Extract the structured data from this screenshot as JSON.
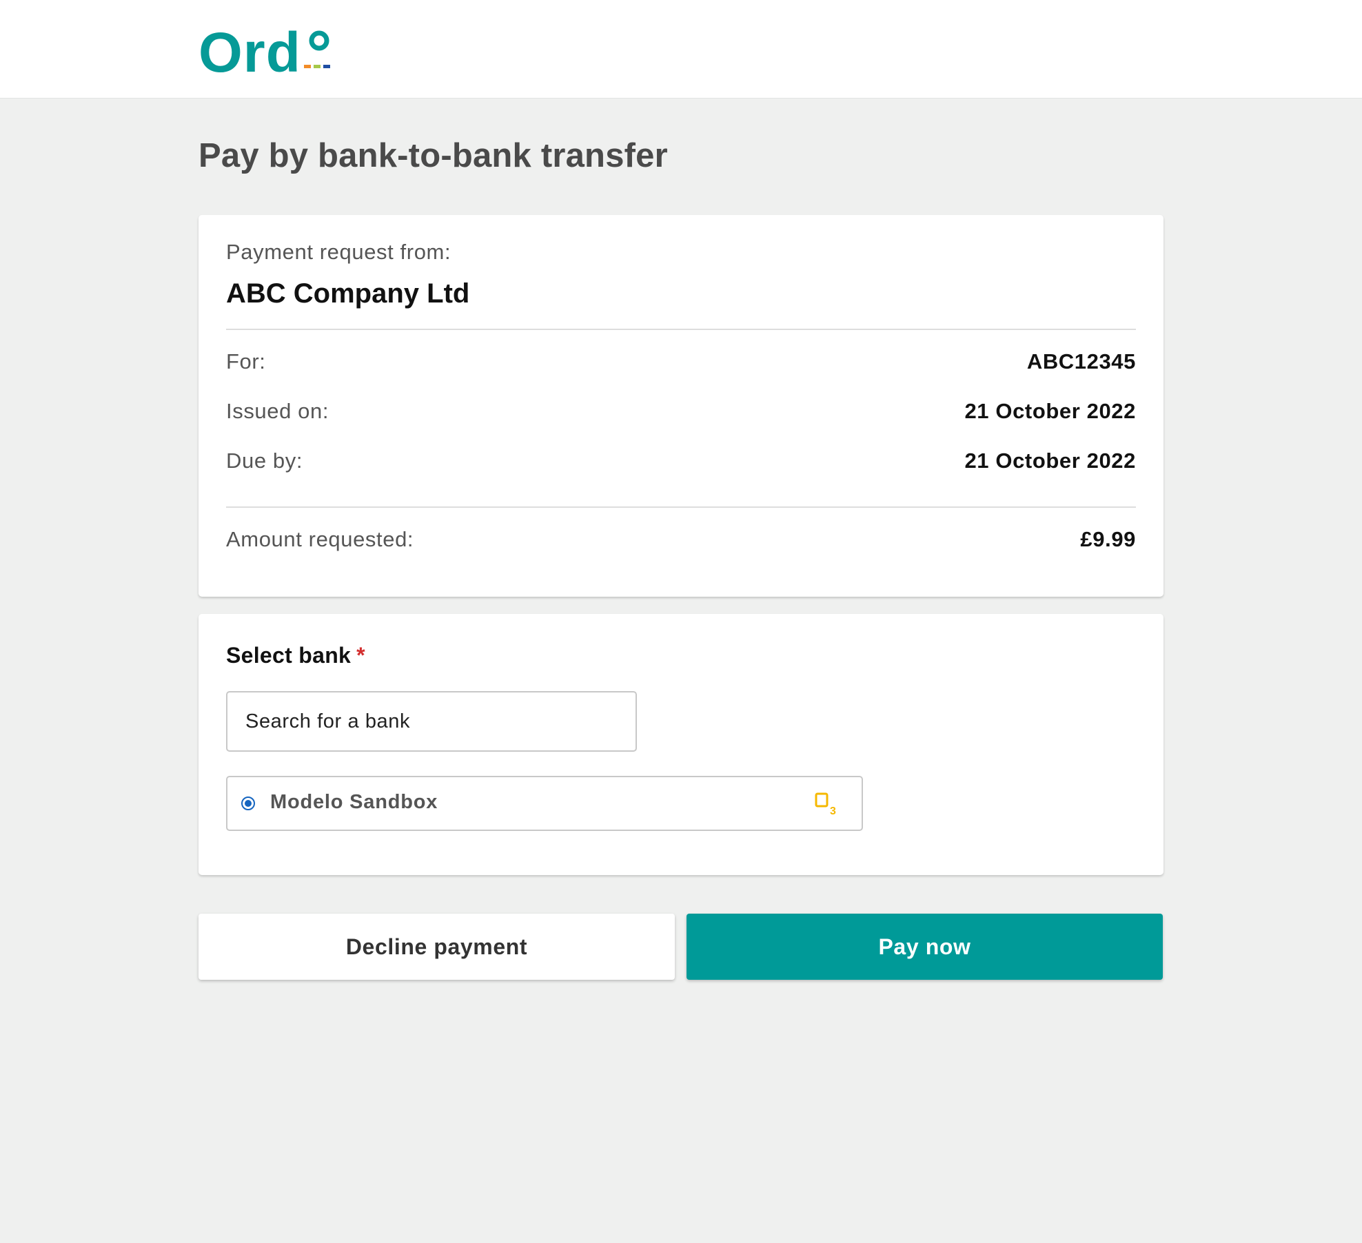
{
  "brand": {
    "logo_text": "Ord",
    "logo_color": "#069a97",
    "accent_color": "#009a98"
  },
  "page": {
    "title": "Pay by bank-to-bank transfer"
  },
  "summary": {
    "from_label": "Payment request from:",
    "company": "ABC Company Ltd",
    "rows": [
      {
        "label": "For:",
        "value": "ABC12345"
      },
      {
        "label": "Issued on:",
        "value": "21 October 2022"
      },
      {
        "label": "Due by:",
        "value": "21 October 2022"
      }
    ],
    "amount_label": "Amount requested:",
    "amount_value": "£9.99"
  },
  "bank_select": {
    "label": "Select bank",
    "required_marker": "*",
    "search_placeholder": "Search for a bank",
    "options": [
      {
        "name": "Modelo Sandbox",
        "selected": true,
        "icon": "o3-bank-icon"
      }
    ]
  },
  "actions": {
    "decline_label": "Decline payment",
    "pay_label": "Pay now"
  }
}
